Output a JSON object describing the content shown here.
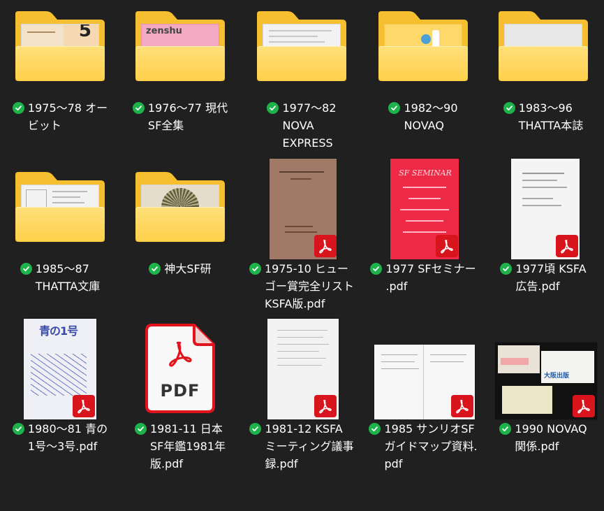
{
  "items": [
    {
      "label": "1975～78 オー\nビット",
      "type": "folder",
      "thumb_text": "5"
    },
    {
      "label": "1976～77 現代\nSF全集",
      "type": "folder",
      "thumb_text": "zenshu"
    },
    {
      "label": "1977～82\nNOVA\nEXPRESS",
      "type": "folder"
    },
    {
      "label": "1982～90\nNOVAQ",
      "type": "folder"
    },
    {
      "label": "1983～96\nTHATTA本誌",
      "type": "folder"
    },
    {
      "label": "1985～87\nTHATTA文庫",
      "type": "folder"
    },
    {
      "label": "神大SF研",
      "type": "folder"
    },
    {
      "label": "1975-10 ヒュー\nゴー賞完全リスト\nKSFA版.pdf",
      "type": "pdf"
    },
    {
      "label": "1977 SFセミナー\n.pdf",
      "type": "pdf",
      "thumb_text": "SF SEMINAR"
    },
    {
      "label": "1977頃 KSFA\n広告.pdf",
      "type": "pdf"
    },
    {
      "label": "1980～81 青の\n1号～3号.pdf",
      "type": "pdf",
      "thumb_text": "青の1号"
    },
    {
      "label": "1981-11 日本\nSF年鑑1981年\n版.pdf",
      "type": "pdf-generic",
      "thumb_text": "PDF"
    },
    {
      "label": "1981-12 KSFA\nミーティング議事\n録.pdf",
      "type": "pdf"
    },
    {
      "label": "1985 サンリオSF\nガイドマップ資料.\npdf",
      "type": "pdf"
    },
    {
      "label": "1990 NOVAQ\n関係.pdf",
      "type": "pdf",
      "thumb_text": "大阪出版"
    }
  ],
  "colors": {
    "background": "#202020",
    "folder": "#ffd04a",
    "sync_check": "#1eb24b",
    "pdf_badge": "#d8141c"
  }
}
